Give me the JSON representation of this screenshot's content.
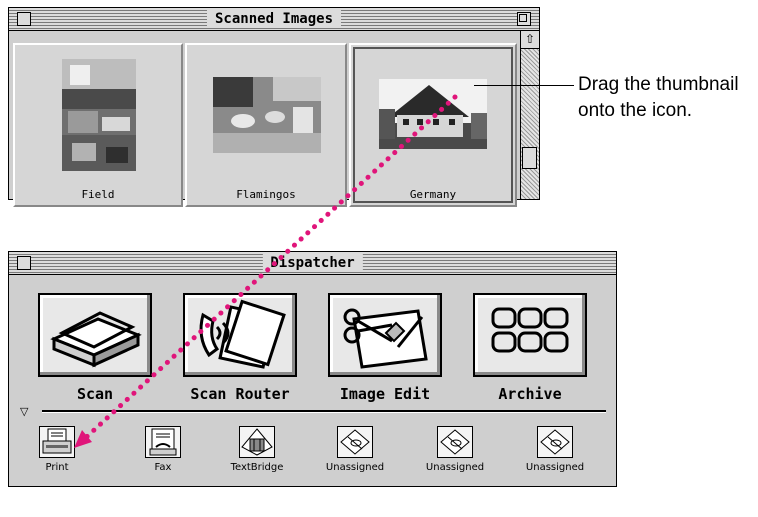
{
  "scanned_window": {
    "title": "Scanned Images",
    "thumbnails": [
      {
        "label": "Field",
        "selected": false
      },
      {
        "label": "Flamingos",
        "selected": false
      },
      {
        "label": "Germany",
        "selected": true
      }
    ]
  },
  "callout": {
    "line1": "Drag the thumbnail",
    "line2": "onto the icon."
  },
  "dispatcher": {
    "title": "Dispatcher",
    "buttons": [
      {
        "label": "Scan",
        "icon": "scanner-icon"
      },
      {
        "label": "Scan Router",
        "icon": "phone-documents-icon"
      },
      {
        "label": "Image Edit",
        "icon": "scissors-edit-icon"
      },
      {
        "label": "Archive",
        "icon": "archive-grid-icon"
      }
    ],
    "destinations": [
      {
        "label": "Print",
        "icon": "printer-icon"
      },
      {
        "label": "Fax",
        "icon": "fax-icon"
      },
      {
        "label": "TextBridge",
        "icon": "textbridge-icon"
      },
      {
        "label": "Unassigned",
        "icon": "unassigned-icon"
      },
      {
        "label": "Unassigned",
        "icon": "unassigned-icon"
      },
      {
        "label": "Unassigned",
        "icon": "unassigned-icon"
      }
    ]
  },
  "colors": {
    "drag_path": "#e0157a",
    "window_bg": "#cfcfcf"
  }
}
